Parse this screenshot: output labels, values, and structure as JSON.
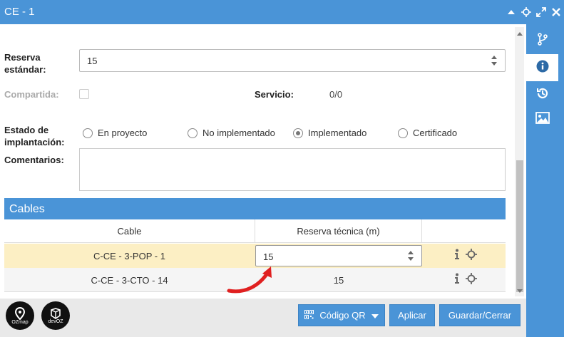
{
  "window": {
    "title": "CE - 1"
  },
  "fields": {
    "reserva_label": "Reserva estándar:",
    "reserva_value": "15",
    "compartida_label": "Compartida:",
    "servicio_label": "Servicio:",
    "servicio_value": "0/0",
    "estado_label": "Estado de implantación:",
    "estado_options": [
      "En proyecto",
      "No implementado",
      "Implementado",
      "Certificado"
    ],
    "estado_selected": "Implementado",
    "comentarios_label": "Comentarios:",
    "comentarios_value": ""
  },
  "cables": {
    "section_title": "Cables",
    "columns": [
      "Cable",
      "Reserva técnica (m)",
      ""
    ],
    "rows": [
      {
        "cable": "C-CE - 3-POP - 1",
        "reserva": "15",
        "editing": true
      },
      {
        "cable": "C-CE - 3-CTO - 14",
        "reserva": "15",
        "editing": false
      }
    ]
  },
  "footer": {
    "logo_ozmap": "OZmap",
    "logo_devoz": "devOZ",
    "qr_button": "Código QR",
    "apply_button": "Aplicar",
    "save_close_button": "Guardar/Cerrar"
  },
  "colors": {
    "accent": "#4a94d7",
    "selected_row": "#fcefc4",
    "annotation": "#e02020"
  },
  "icons": {
    "titlebar": [
      "collapse-up-icon",
      "move-icon",
      "expand-icon",
      "close-icon"
    ],
    "rail": [
      "branch-icon",
      "info-icon",
      "history-icon",
      "image-icon"
    ],
    "row_actions": [
      "info-icon",
      "locate-icon"
    ]
  }
}
